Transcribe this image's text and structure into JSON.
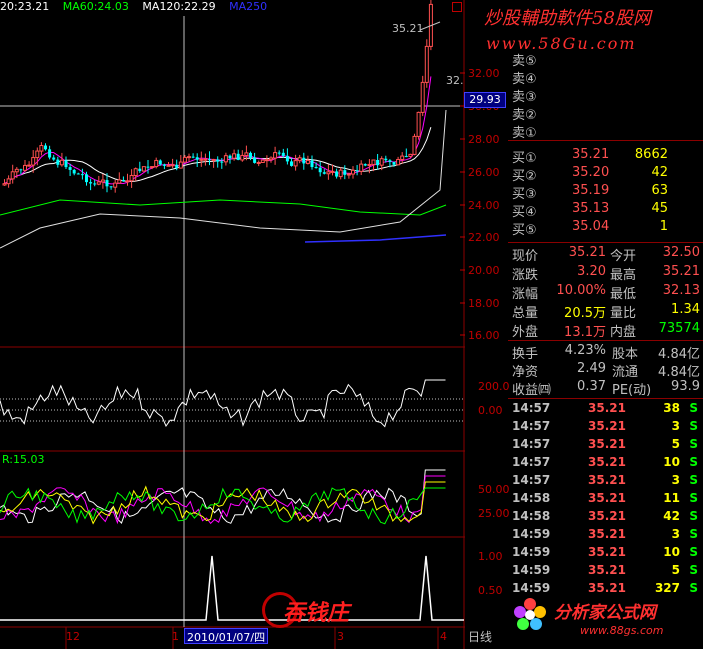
{
  "ma_bar": {
    "ma20": "20:23.21",
    "ma60": "MA60:24.03",
    "ma120": "MA120:22.29",
    "ma250": "MA250"
  },
  "price_axis": [
    "32.00",
    "30.00",
    "28.00",
    "26.00",
    "24.00",
    "22.00",
    "20.00",
    "18.00",
    "16.00"
  ],
  "high_label": "35.21",
  "price_right_tag": "32.",
  "crosshair_value": "29.93",
  "osc1_axis": [
    "200.0",
    "0.00"
  ],
  "osc2_label": "R:15.03",
  "osc2_axis": [
    "50.00",
    "25.00"
  ],
  "osc3_axis": [
    "1.00",
    "0.50"
  ],
  "date_axis": {
    "a": "12",
    "b": "1",
    "cursor": "2010/01/07/四",
    "c": "3",
    "d": "4",
    "period": "日线"
  },
  "watermarks": {
    "top1": "炒股輔助軟件58股网",
    "top2": "www.58Gu.com",
    "bottom_left": "吞钱庄",
    "bottom_right1": "分析家公式网",
    "bottom_right2": "www.88gs.com"
  },
  "order_book": {
    "asks": [
      {
        "label": "卖⑤",
        "price": "",
        "vol": ""
      },
      {
        "label": "卖④",
        "price": "",
        "vol": ""
      },
      {
        "label": "卖③",
        "price": "",
        "vol": ""
      },
      {
        "label": "卖②",
        "price": "",
        "vol": ""
      },
      {
        "label": "卖①",
        "price": "",
        "vol": ""
      }
    ],
    "bids": [
      {
        "label": "买①",
        "price": "35.21",
        "vol": "8662"
      },
      {
        "label": "买②",
        "price": "35.20",
        "vol": "42"
      },
      {
        "label": "买③",
        "price": "35.19",
        "vol": "63"
      },
      {
        "label": "买④",
        "price": "35.13",
        "vol": "45"
      },
      {
        "label": "买⑤",
        "price": "35.04",
        "vol": "1"
      }
    ]
  },
  "quote": [
    {
      "l1": "现价",
      "v1": "35.21",
      "l2": "今开",
      "v2": "32.50"
    },
    {
      "l1": "涨跌",
      "v1": "3.20",
      "l2": "最高",
      "v2": "35.21"
    },
    {
      "l1": "涨幅",
      "v1": "10.00%",
      "l2": "最低",
      "v2": "32.13"
    },
    {
      "l1": "总量",
      "v1": "20.5万",
      "l2": "量比",
      "v2": "1.34"
    },
    {
      "l1": "外盘",
      "v1": "13.1万",
      "l2": "内盘",
      "v2": "73574"
    }
  ],
  "fundamentals": [
    {
      "l1": "换手",
      "v1": "4.23%",
      "l2": "股本",
      "v2": "4.84亿"
    },
    {
      "l1": "净资",
      "v1": "2.49",
      "l2": "流通",
      "v2": "4.84亿"
    },
    {
      "l1": "收益㈣",
      "v1": "0.37",
      "l2": "PE(动)",
      "v2": "93.9"
    }
  ],
  "ticks": [
    {
      "time": "14:57",
      "price": "35.21",
      "vol": "38",
      "side": "S"
    },
    {
      "time": "14:57",
      "price": "35.21",
      "vol": "3",
      "side": "S"
    },
    {
      "time": "14:57",
      "price": "35.21",
      "vol": "5",
      "side": "S"
    },
    {
      "time": "14:57",
      "price": "35.21",
      "vol": "10",
      "side": "S"
    },
    {
      "time": "14:57",
      "price": "35.21",
      "vol": "3",
      "side": "S"
    },
    {
      "time": "14:58",
      "price": "35.21",
      "vol": "11",
      "side": "S"
    },
    {
      "time": "14:58",
      "price": "35.21",
      "vol": "42",
      "side": "S"
    },
    {
      "time": "14:59",
      "price": "35.21",
      "vol": "3",
      "side": "S"
    },
    {
      "time": "14:59",
      "price": "35.21",
      "vol": "10",
      "side": "S"
    },
    {
      "time": "14:59",
      "price": "35.21",
      "vol": "5",
      "side": "S"
    },
    {
      "time": "14:59",
      "price": "35.21",
      "vol": "327",
      "side": "S"
    }
  ],
  "colors": {
    "up": "#ff5050",
    "down": "#00ffff",
    "ma20": "#ffffff",
    "ma60": "#00ff00",
    "ma120": "#ffffff",
    "ma250": "#3030ff",
    "grid": "#8b0000"
  }
}
